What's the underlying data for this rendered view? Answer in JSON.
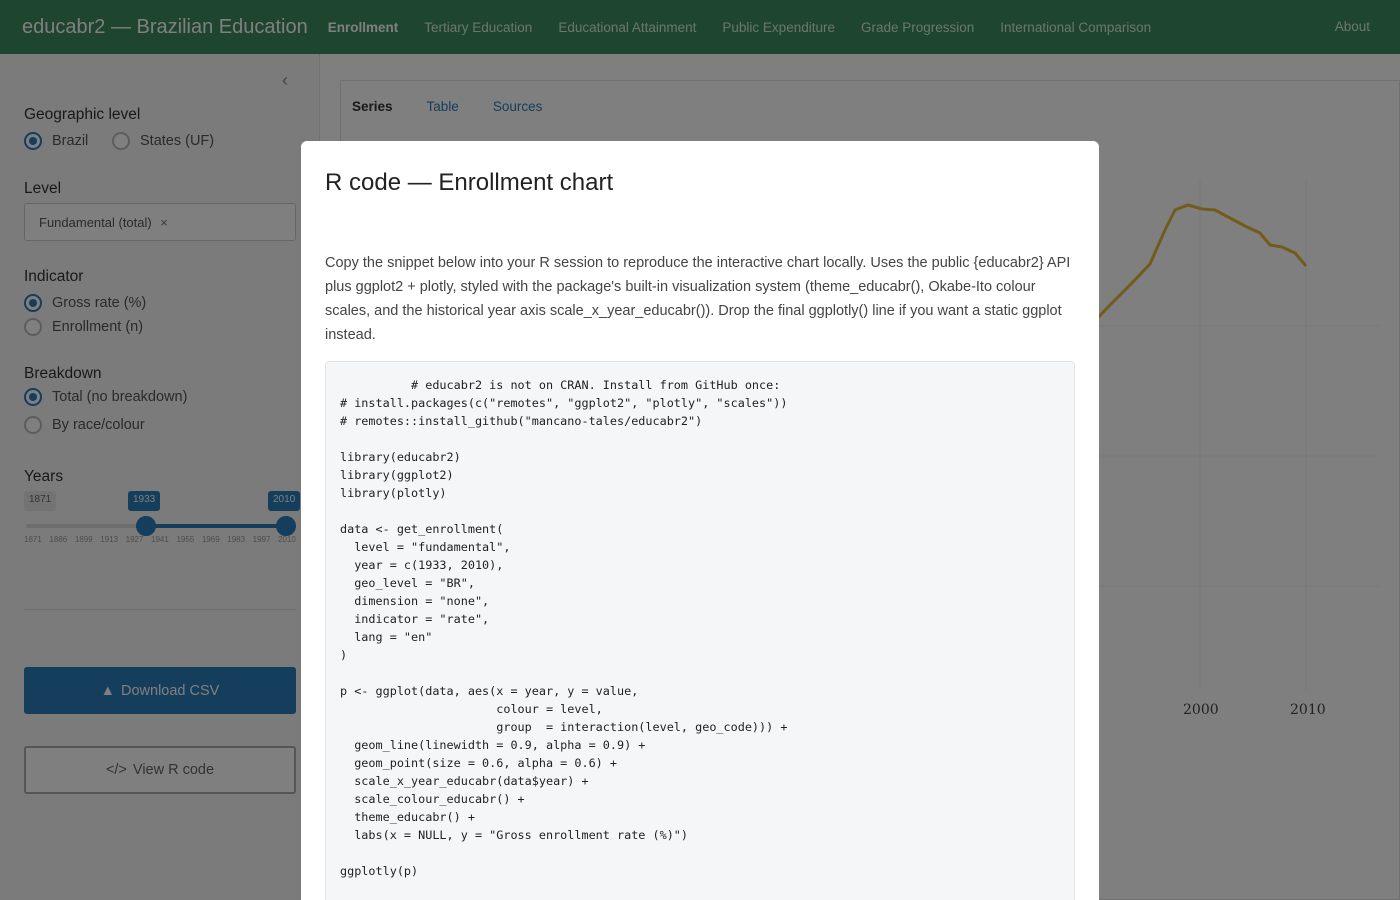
{
  "navbar": {
    "brand": "educabr2 — Brazilian Education",
    "items": [
      "Enrollment",
      "Tertiary Education",
      "Educational Attainment",
      "Public Expenditure",
      "Grade Progression",
      "International Comparison"
    ],
    "about": "About"
  },
  "sidebar": {
    "geo_label": "Geographic level",
    "geo_options": [
      "Brazil",
      "States (UF)"
    ],
    "geo_selected": "Brazil",
    "level_label": "Level",
    "level_chip": "Fundamental (total)",
    "level_chip_remove": "×",
    "indicator_label": "Indicator",
    "indicator_options": [
      "Gross rate (%)",
      "Enrollment (n)"
    ],
    "indicator_selected": "Gross rate (%)",
    "breakdown_label": "Breakdown",
    "breakdown_options": [
      "Total (no breakdown)",
      "By race/colour"
    ],
    "breakdown_selected": "Total (no breakdown)",
    "years_label": "Years",
    "slider": {
      "min_tag": "1871",
      "from_tag": "1933",
      "to_tag": "2010",
      "ticks": [
        "1871",
        "1886",
        "1899",
        "1913",
        "1927",
        "1941",
        "1955",
        "1969",
        "1983",
        "1997",
        "2010"
      ]
    },
    "download_label": "Download CSV",
    "code_label": "View R code",
    "collapse_icon": "‹"
  },
  "main": {
    "tabs": [
      "Series",
      "Table",
      "Sources"
    ],
    "active_tab": "Series",
    "x_ticks_visible": [
      "2000",
      "2010"
    ]
  },
  "modal": {
    "title": "R code — Enrollment chart",
    "description": "Copy the snippet below into your R session to reproduce the interactive chart locally. Uses the public {educabr2} API plus ggplot2 + plotly, styled with the package's built-in visualization system (theme_educabr(), Okabe-Ito colour scales, and the historical year axis scale_x_year_educabr()). Drop the final ggplotly() line if you want a static ggplot instead.",
    "code": "          # educabr2 is not on CRAN. Install from GitHub once:\n# install.packages(c(\"remotes\", \"ggplot2\", \"plotly\", \"scales\"))\n# remotes::install_github(\"mancano-tales/educabr2\")\n\nlibrary(educabr2)\nlibrary(ggplot2)\nlibrary(plotly)\n\ndata <- get_enrollment(\n  level = \"fundamental\",\n  year = c(1933, 2010),\n  geo_level = \"BR\",\n  dimension = \"none\",\n  indicator = \"rate\",\n  lang = \"en\"\n)\n\np <- ggplot(data, aes(x = year, y = value,\n                      colour = level,\n                      group  = interaction(level, geo_code))) +\n  geom_line(linewidth = 0.9, alpha = 0.9) +\n  geom_point(size = 0.6, alpha = 0.6) +\n  scale_x_year_educabr(data$year) +\n  scale_colour_educabr() +\n  theme_educabr() +\n  labs(x = NULL, y = \"Gross enrollment rate (%)\")\n\nggplotly(p)"
  },
  "colors": {
    "navbar": "#3c8a5a",
    "accent": "#2b7bb9",
    "series_line": "#e6b63d"
  }
}
